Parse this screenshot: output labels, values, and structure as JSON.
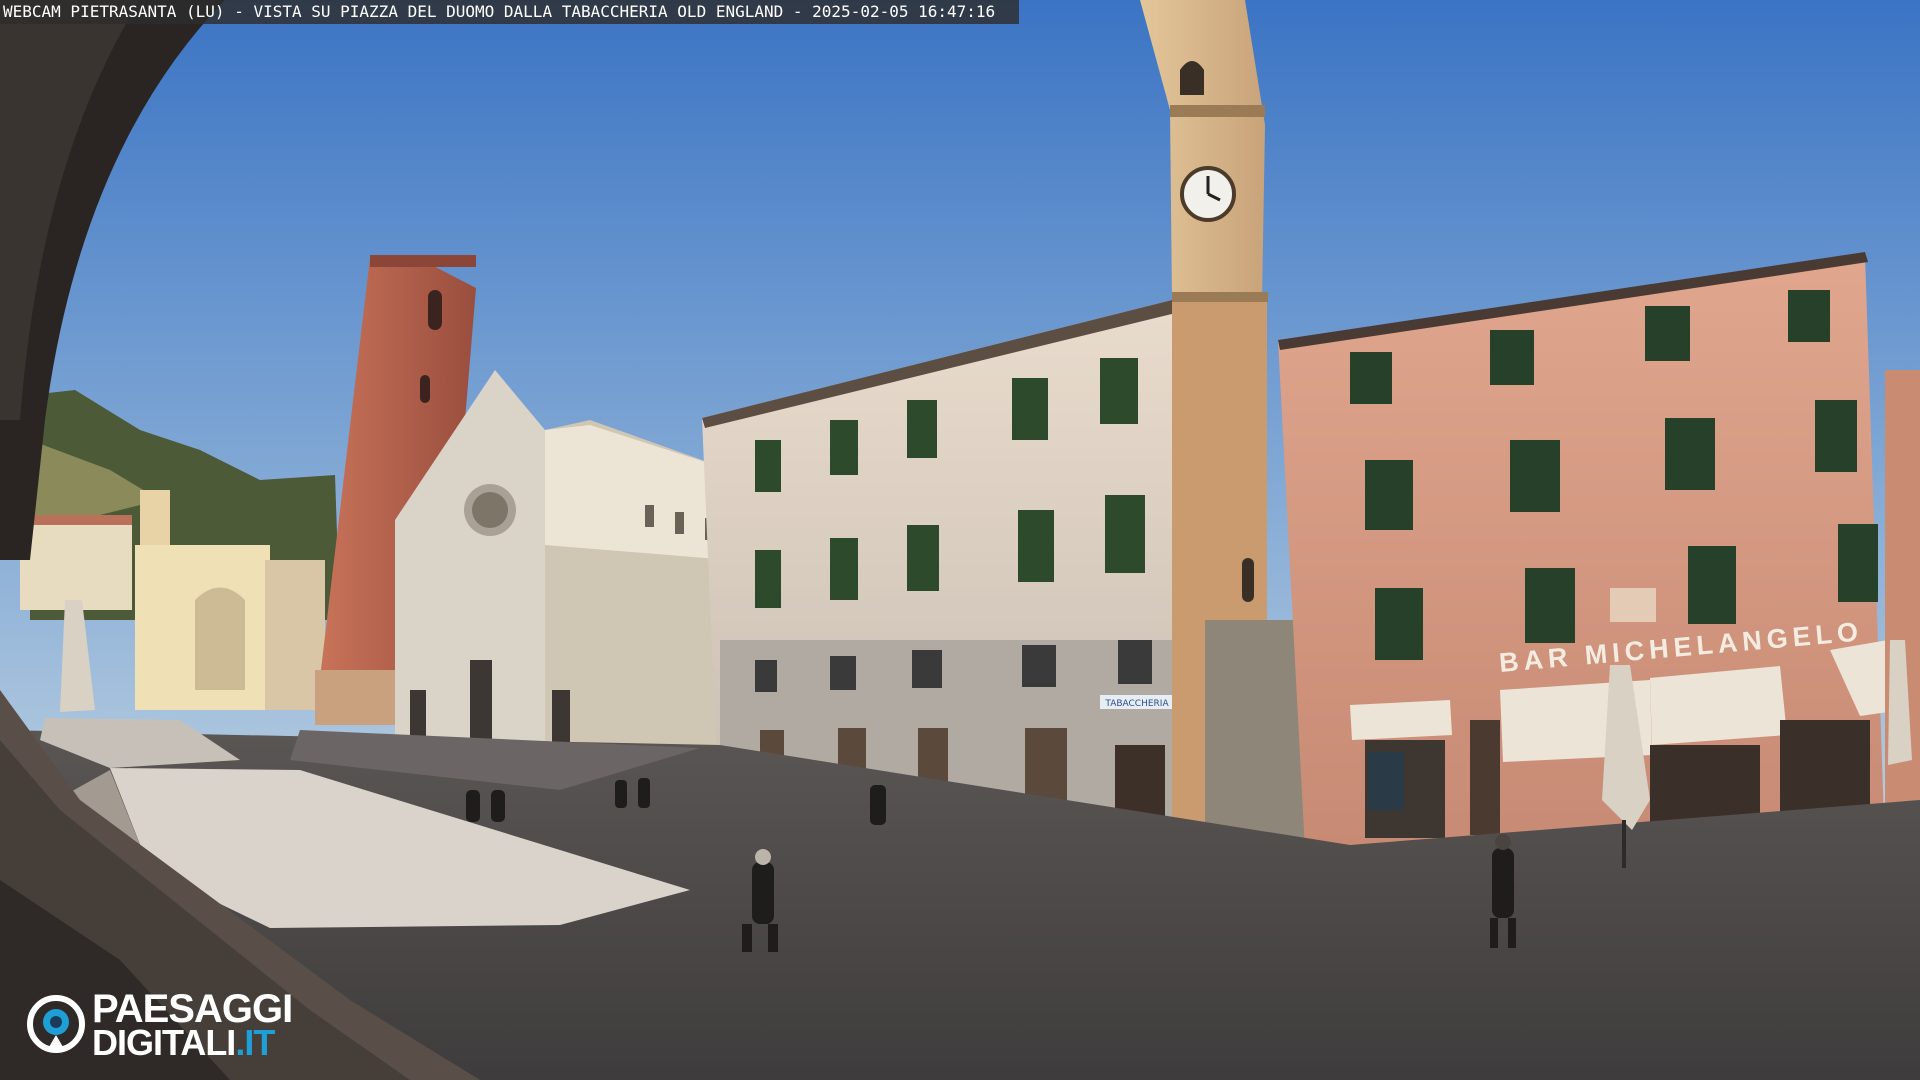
{
  "overlay": {
    "caption": "WEBCAM PIETRASANTA (LU) - VISTA SU PIAZZA DEL DUOMO DALLA TABACCHERIA OLD ENGLAND - 2025-02-05 16:47:16"
  },
  "signs": {
    "bar": "BAR MICHELANGELO",
    "tabaccheria": "TABACCHERIA"
  },
  "logo": {
    "line1": "PAESAGGI",
    "line2_main": "DIGITALI",
    "line2_tld": ".IT",
    "accent_color": "#1e9fd6"
  },
  "colors": {
    "sky_top": "#3f79c7",
    "sky_bottom": "#a9c4dc",
    "pink_building": "#d99d84",
    "cream_building": "#e4d6c8",
    "bell_tower": "#b8634e",
    "piazza": "#4f4c4c"
  }
}
